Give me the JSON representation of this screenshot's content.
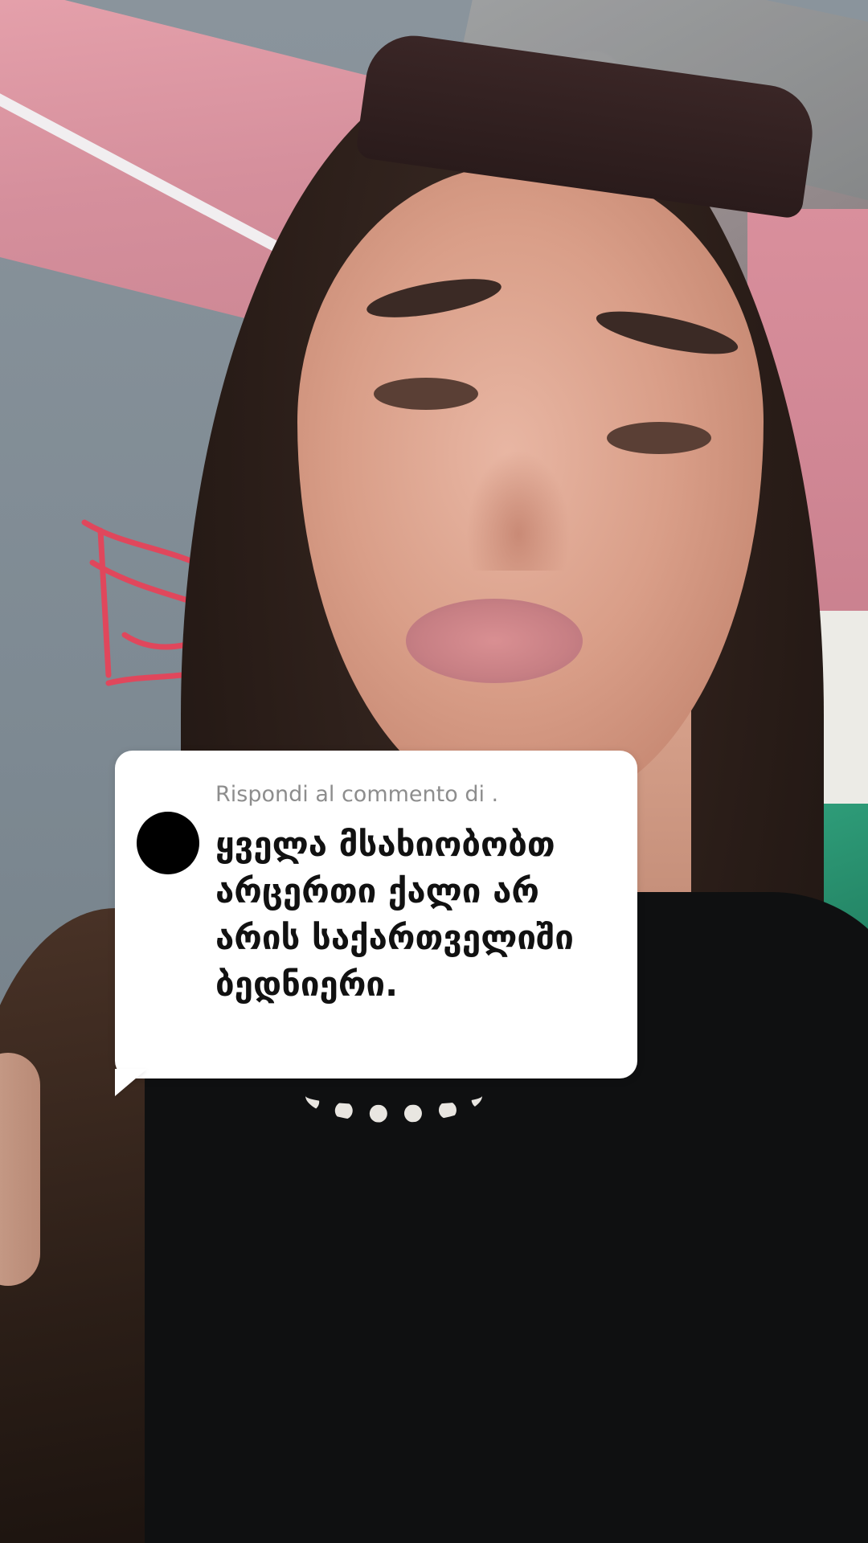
{
  "comment_reply": {
    "header": "Rispondi al commento di .",
    "text": "ყველა მსახიობობთ არცერთი ქალი არ არის საქართველიში ბედნიერი."
  },
  "colors": {
    "card_background": "#ffffff",
    "header_text": "#8d8d8d",
    "body_text": "#111111",
    "avatar": "#000000"
  }
}
